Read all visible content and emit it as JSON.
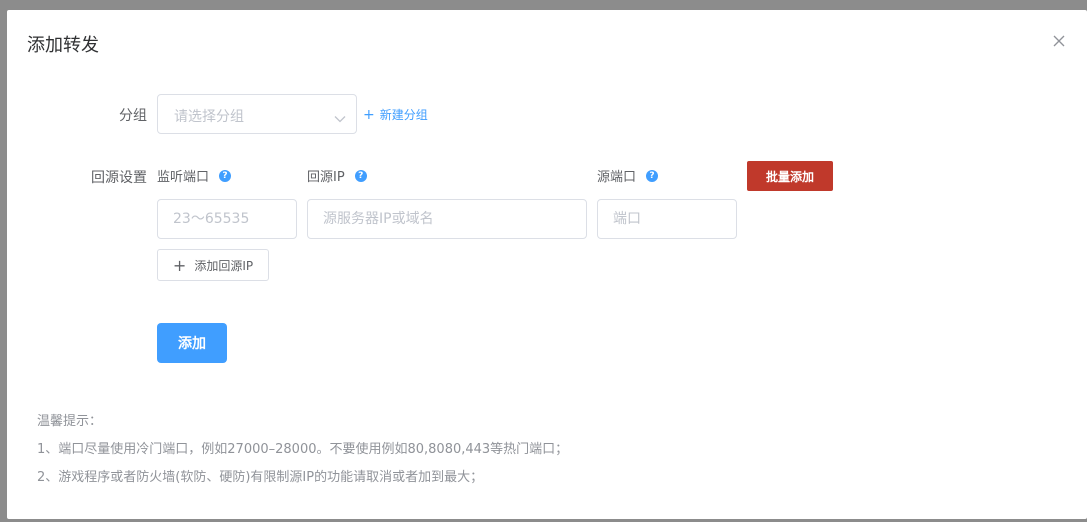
{
  "dialog": {
    "title": "添加转发",
    "close_icon": "close-icon"
  },
  "form": {
    "group": {
      "label": "分组",
      "placeholder": "请选择分组",
      "new_group_label": "新建分组"
    },
    "origin": {
      "label": "回源设置",
      "listen_port_label": "监听端口",
      "origin_ip_label": "回源IP",
      "origin_port_label": "源端口",
      "help_icon_text": "?",
      "batch_add_label": "批量添加",
      "listen_port_placeholder": "23～65535",
      "origin_ip_placeholder": "源服务器IP或域名",
      "origin_port_placeholder": "端口",
      "add_origin_ip_label": "添加回源IP",
      "plus_text": "+"
    },
    "submit_label": "添加"
  },
  "tips": {
    "title": "温馨提示：",
    "line1": "1、端口尽量使用冷门端口，例如27000–28000。不要使用例如80,8080,443等热门端口；",
    "line2": "2、游戏程序或者防火墙(软防、硬防)有限制源IP的功能请取消或者加到最大；"
  },
  "colors": {
    "primary": "#409eff",
    "danger": "#c0392b",
    "overlay": "#8c8c8c"
  }
}
